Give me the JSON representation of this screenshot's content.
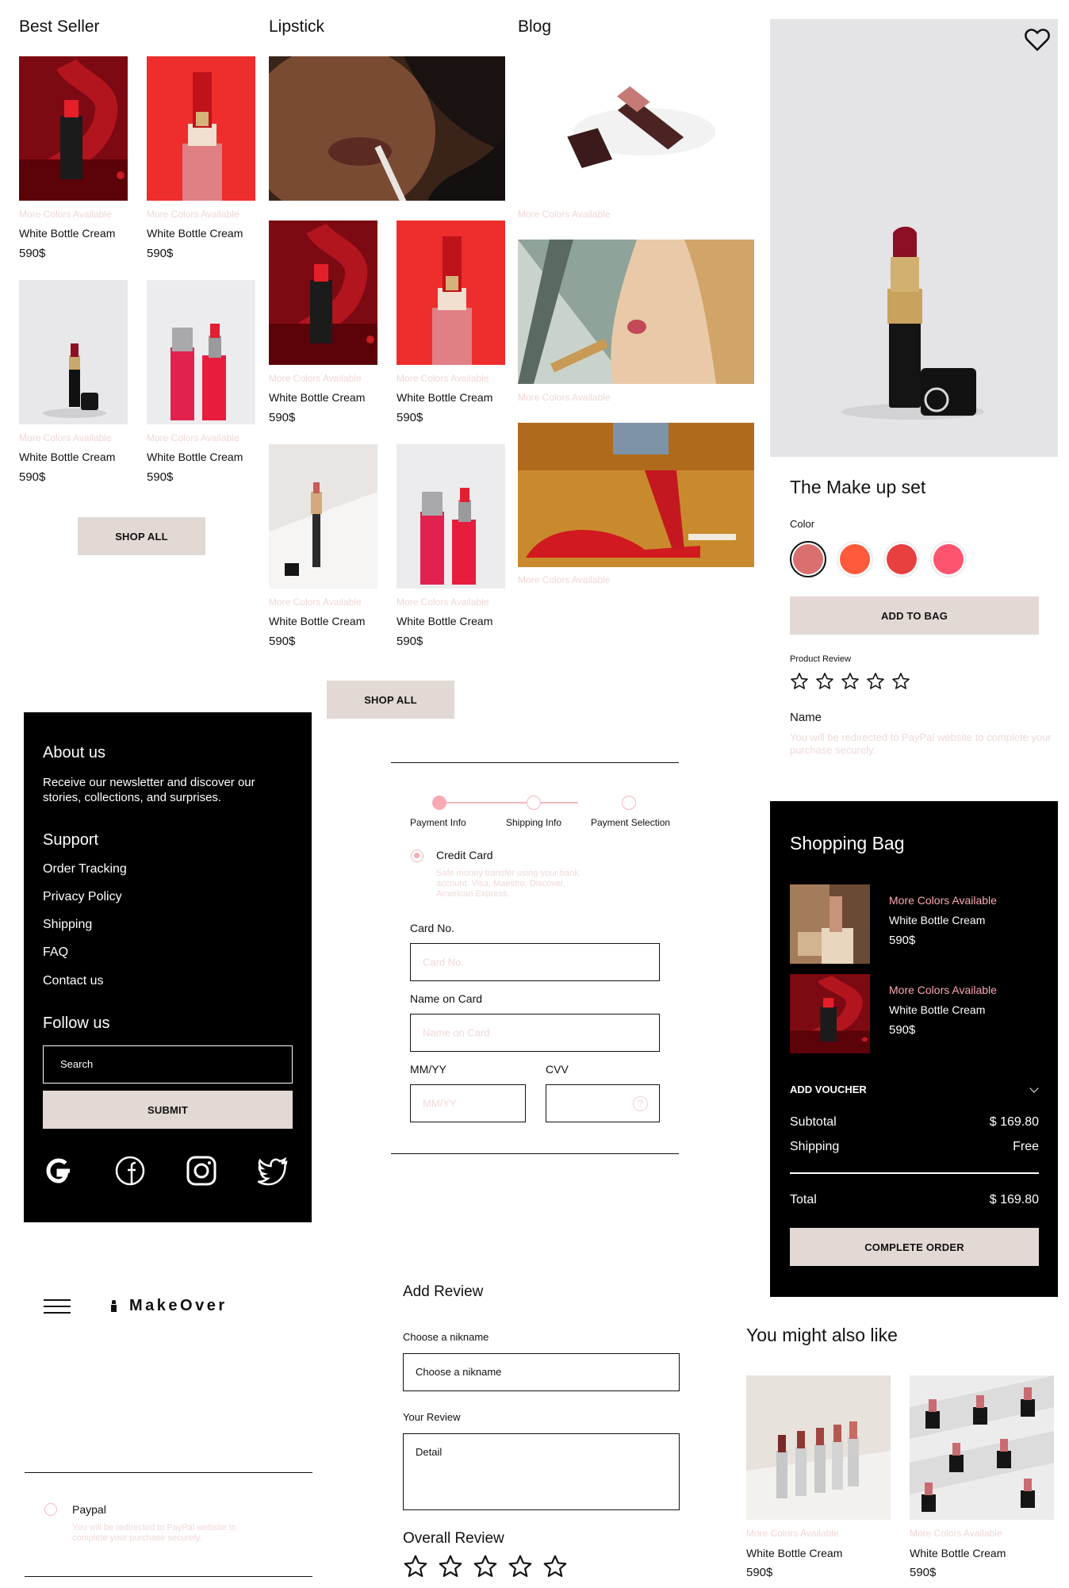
{
  "best_seller": {
    "title": "Best Seller",
    "products": [
      {
        "more": "More Colors Available",
        "name": "White Bottle Cream",
        "price": "590$"
      },
      {
        "more": "More Colors Available",
        "name": "White Bottle Cream",
        "price": "590$"
      },
      {
        "more": "More Colors Available",
        "name": "White Bottle Cream",
        "price": "590$"
      },
      {
        "more": "More Colors Available",
        "name": "White Bottle Cream",
        "price": "590$"
      }
    ],
    "shop_all": "SHOP ALL"
  },
  "lipstick": {
    "title": "Lipstick",
    "products": [
      {
        "more": "More Colors Available",
        "name": "White Bottle Cream",
        "price": "590$"
      },
      {
        "more": "More Colors Available",
        "name": "White Bottle Cream",
        "price": "590$"
      },
      {
        "more": "More Colors Available",
        "name": "White Bottle Cream",
        "price": "590$"
      },
      {
        "more": "More Colors Available",
        "name": "White Bottle Cream",
        "price": "590$"
      }
    ],
    "shop_all": "SHOP ALL"
  },
  "blog": {
    "title": "Blog",
    "items": [
      {
        "more": "More Colors Available"
      },
      {
        "more": "More Colors Available"
      },
      {
        "more": "More Colors Available"
      }
    ]
  },
  "product_detail": {
    "title": "The Make up set",
    "color_label": "Color",
    "colors": [
      "#d9706f",
      "#ff5a3c",
      "#e8403f",
      "#ff5470"
    ],
    "add_to_bag": "ADD TO BAG",
    "review_label": "Product Review",
    "name_label": "Name",
    "name_note": "You will be redirected to PayPal website to complete your purchase securely."
  },
  "footer": {
    "about_title": "About us",
    "about_text": "Receive our newsletter and discover our stories, collections, and surprises.",
    "support_title": "Support",
    "links": [
      "Order Tracking",
      "Privacy Policy",
      "Shipping",
      "FAQ",
      "Contact us"
    ],
    "follow_title": "Follow us",
    "search_placeholder": "Search",
    "submit": "SUBMIT",
    "social_icons": [
      "google-icon",
      "facebook-icon",
      "instagram-icon",
      "twitter-icon"
    ]
  },
  "payment": {
    "steps": [
      "Payment Info",
      "Shipping Info",
      "Payment Selection"
    ],
    "method_label": "Credit Card",
    "method_note": "Safe money transfer using your bank account. Visa, Maestro, Discover, American Express.",
    "card_no_label": "Card No.",
    "card_no_placeholder": "Card No.",
    "name_label": "Name on Card",
    "name_placeholder": "Name on Card",
    "expiry_label": "MM/YY",
    "expiry_placeholder": "MM/YY",
    "cvv_label": "CVV"
  },
  "shopping_bag": {
    "title": "Shopping Bag",
    "items": [
      {
        "more": "More Colors Available",
        "name": "White Bottle Cream",
        "price": "590$"
      },
      {
        "more": "More Colors Available",
        "name": "White Bottle Cream",
        "price": "590$"
      }
    ],
    "voucher": "ADD VOUCHER",
    "subtotal_label": "Subtotal",
    "subtotal": "$ 169.80",
    "shipping_label": "Shipping",
    "shipping": "Free",
    "total_label": "Total",
    "total": "$ 169.80",
    "complete": "COMPLETE ORDER"
  },
  "header": {
    "brand": "MakeOver"
  },
  "paypal": {
    "label": "Paypal",
    "note": "You will be redirected to PayPal website to complete your purchase securely."
  },
  "add_review": {
    "title": "Add Review",
    "nickname_label": "Choose a nikname",
    "nickname_value": "Choose a nikname",
    "review_label": "Your Review",
    "review_value": "Detail",
    "overall_label": "Overall Review"
  },
  "also_like": {
    "title": "You might also like",
    "products": [
      {
        "more": "More Colors Available",
        "name": "White Bottle Cream",
        "price": "590$"
      },
      {
        "more": "More Colors Available",
        "name": "White Bottle Cream",
        "price": "590$"
      }
    ]
  }
}
